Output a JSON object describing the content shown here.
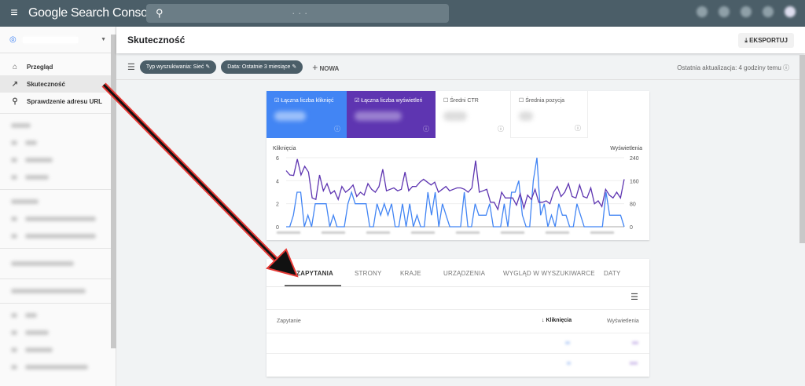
{
  "topbar": {
    "menu_icon": "hamburger-icon",
    "app_title": "Google Search Console",
    "search_icon": "search-icon",
    "search_value": "· · ·"
  },
  "sidebar": {
    "items": [
      {
        "label": "Przegląd",
        "icon": "home-icon"
      },
      {
        "label": "Skuteczność",
        "icon": "trending-up-icon",
        "active": true
      },
      {
        "label": "Sprawdzenie adresu URL",
        "icon": "search-icon"
      }
    ]
  },
  "header": {
    "title": "Skuteczność",
    "export_label": "EKSPORTUJ"
  },
  "filters": {
    "chips": [
      "Typ wyszukiwania: Sieć",
      "Data: Ostatnie 3 miesiące"
    ],
    "new_label": "NOWA",
    "last_update": "Ostatnia aktualizacja: 4 godziny temu"
  },
  "metrics": [
    {
      "label": "Łączna liczba kliknięć",
      "checked": true,
      "color": "#4285f4"
    },
    {
      "label": "Łączna liczba wyświetleń",
      "checked": true,
      "color": "#5e35b1"
    },
    {
      "label": "Średni CTR",
      "checked": false
    },
    {
      "label": "Średnia pozycja",
      "checked": false
    }
  ],
  "chart_data": {
    "type": "line",
    "ylabel_left": "Kliknięcia",
    "ylabel_right": "Wyświetlenia",
    "yticks_left": [
      "0",
      "2",
      "4",
      "6"
    ],
    "yticks_right": [
      "0",
      "80",
      "160",
      "240"
    ],
    "ylim_left": [
      0,
      6
    ],
    "ylim_right": [
      0,
      240
    ],
    "grid": true,
    "series": [
      {
        "name": "Kliknięcia",
        "color": "#4285f4",
        "axis": "left",
        "values": [
          0,
          0,
          1,
          3,
          3,
          0,
          1,
          0,
          2,
          2,
          2,
          2,
          0,
          1,
          0,
          0,
          0,
          2,
          3,
          2,
          2,
          2,
          2,
          0,
          0,
          2,
          1,
          2,
          1,
          2,
          0,
          0,
          2,
          0,
          2,
          0,
          1,
          0,
          0,
          3,
          1,
          3,
          0,
          2,
          1,
          0,
          0,
          0,
          0,
          3,
          0,
          0,
          2,
          1,
          1,
          1,
          2,
          0,
          0,
          0,
          2,
          0,
          3,
          3,
          4,
          1,
          0,
          0,
          4,
          6,
          1,
          2,
          0,
          1,
          0,
          2,
          1,
          1,
          0,
          0,
          2,
          1,
          0,
          0,
          0,
          0,
          0,
          0,
          3,
          1,
          1,
          1,
          1,
          0
        ]
      },
      {
        "name": "Wyświetlenia",
        "color": "#5e35b1",
        "axis": "right",
        "values": [
          195,
          180,
          178,
          235,
          180,
          210,
          190,
          100,
          95,
          180,
          125,
          150,
          115,
          125,
          95,
          140,
          120,
          130,
          145,
          105,
          120,
          110,
          150,
          130,
          120,
          140,
          200,
          125,
          130,
          135,
          125,
          130,
          190,
          125,
          140,
          140,
          155,
          165,
          155,
          145,
          155,
          120,
          130,
          140,
          125,
          130,
          135,
          135,
          130,
          120,
          135,
          230,
          120,
          125,
          130,
          85,
          85,
          60,
          120,
          100,
          100,
          100,
          75,
          115,
          65,
          110,
          95,
          130,
          85,
          85,
          90,
          80,
          120,
          140,
          105,
          120,
          150,
          105,
          100,
          145,
          105,
          100,
          135,
          80,
          90,
          70,
          130,
          110,
          100,
          120,
          100,
          165
        ]
      }
    ]
  },
  "table": {
    "tabs": [
      "ZAPYTANIA",
      "STRONY",
      "KRAJE",
      "URZĄDZENIA",
      "WYGLĄD W WYSZUKIWARCE",
      "DATY"
    ],
    "active_tab": 0,
    "columns": [
      "Zapytanie",
      "Kliknięcia",
      "Wyświetlenia"
    ],
    "sort_icon": "arrow-down-icon",
    "filter_icon": "filter-icon"
  },
  "annotation": {
    "arrow_color": "#e53935"
  }
}
